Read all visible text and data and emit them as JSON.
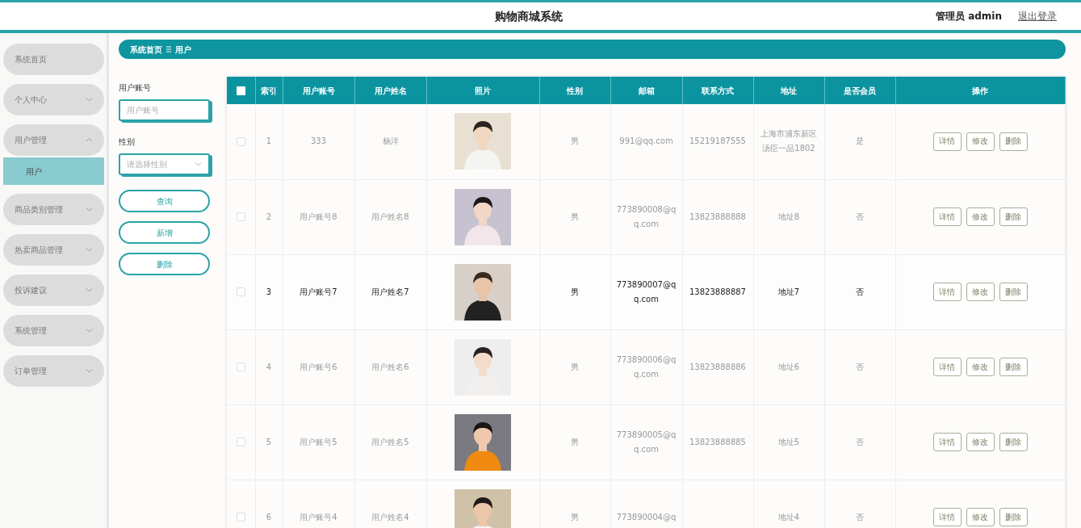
{
  "header": {
    "title": "购物商城系统",
    "user": "管理员 admin",
    "logout": "退出登录"
  },
  "sidebar": {
    "items": [
      {
        "kind": "link",
        "label": "系统首页"
      },
      {
        "kind": "group",
        "label": "个人中心",
        "expanded": false
      },
      {
        "kind": "group",
        "label": "用户管理",
        "expanded": true,
        "children": [
          {
            "label": "用户",
            "selected": true
          }
        ]
      },
      {
        "kind": "group",
        "label": "商品类别管理",
        "expanded": false
      },
      {
        "kind": "group",
        "label": "热卖商品管理",
        "expanded": false
      },
      {
        "kind": "group",
        "label": "投诉建议",
        "expanded": false
      },
      {
        "kind": "group",
        "label": "系统管理",
        "expanded": false
      },
      {
        "kind": "group",
        "label": "订单管理",
        "expanded": false
      }
    ]
  },
  "breadcrumb": [
    "系统首页",
    "用户"
  ],
  "filters": [
    {
      "kind": "text",
      "label": "用户账号",
      "placeholder": "用户账号"
    },
    {
      "kind": "select",
      "label": "性别",
      "placeholder": "请选择性别"
    }
  ],
  "filter_buttons": [
    "查询",
    "新增",
    "删除"
  ],
  "table": {
    "header_checked": false,
    "columns": [
      "索引",
      "用户账号",
      "用户姓名",
      "照片",
      "性别",
      "邮箱",
      "联系方式",
      "地址",
      "是否会员",
      "操作"
    ],
    "rows": [
      {
        "checked": false,
        "hovered": false,
        "cells": [
          "1",
          "333",
          "杨洋",
          "",
          "男",
          "991@qq.com",
          "15219187555",
          "上海市浦东新区汤臣一品1802",
          "是"
        ],
        "actions": [
          "详情",
          "修改",
          "删除"
        ]
      },
      {
        "checked": false,
        "hovered": false,
        "cells": [
          "2",
          "用户账号8",
          "用户姓名8",
          "",
          "男",
          "773890008@qq.com",
          "13823888888",
          "地址8",
          "否"
        ],
        "actions": [
          "详情",
          "修改",
          "删除"
        ]
      },
      {
        "checked": false,
        "hovered": true,
        "cells": [
          "3",
          "用户账号7",
          "用户姓名7",
          "",
          "男",
          "773890007@qq.com",
          "13823888887",
          "地址7",
          "否"
        ],
        "actions": [
          "详情",
          "修改",
          "删除"
        ]
      },
      {
        "checked": false,
        "hovered": false,
        "cells": [
          "4",
          "用户账号6",
          "用户姓名6",
          "",
          "男",
          "773890006@qq.com",
          "13823888886",
          "地址6",
          "否"
        ],
        "actions": [
          "详情",
          "修改",
          "删除"
        ]
      },
      {
        "checked": false,
        "hovered": false,
        "cells": [
          "5",
          "用户账号5",
          "用户姓名5",
          "",
          "男",
          "773890005@qq.com",
          "13823888885",
          "地址5",
          "否"
        ],
        "actions": [
          "详情",
          "修改",
          "删除"
        ]
      },
      {
        "checked": false,
        "hovered": false,
        "cells": [
          "6",
          "用户账号4",
          "用户姓名4",
          "",
          "男",
          "773890004@q",
          "",
          "地址4",
          "否"
        ],
        "actions": [
          "详情",
          "修改",
          "删除"
        ]
      }
    ]
  }
}
